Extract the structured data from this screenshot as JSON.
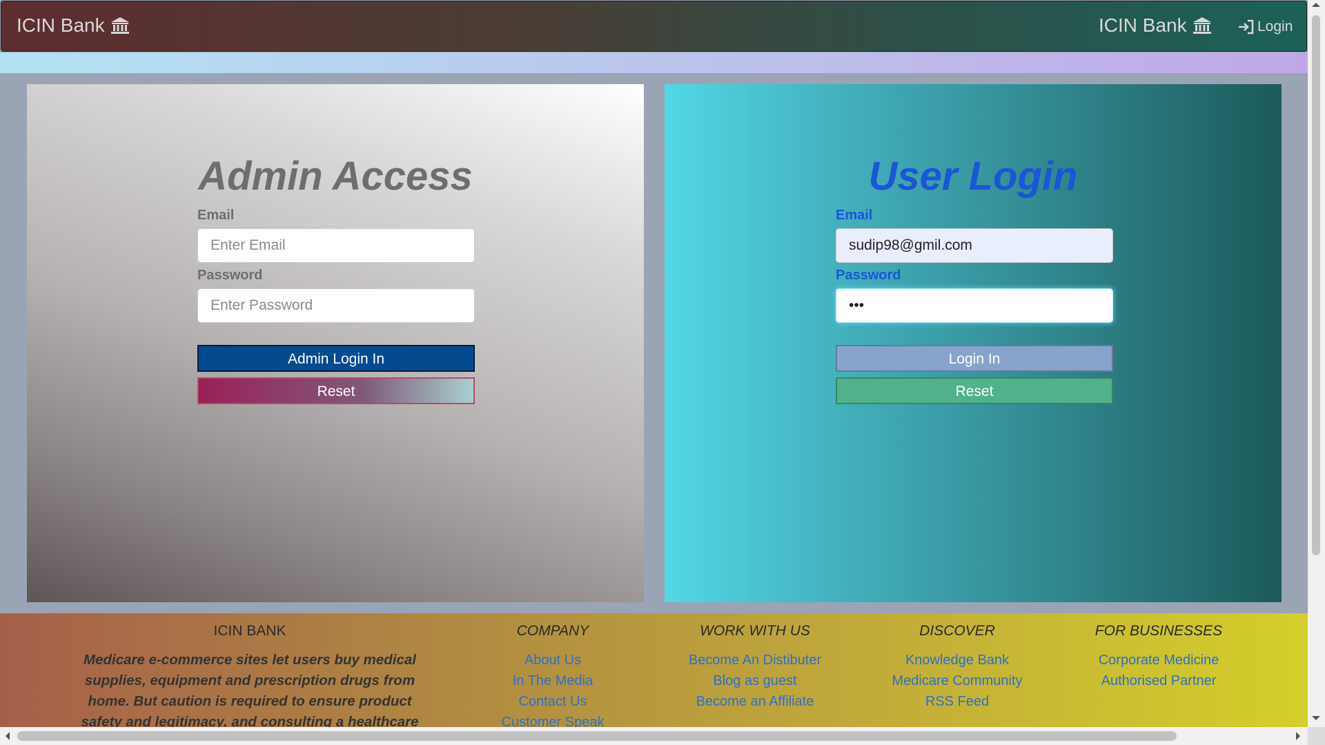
{
  "navbar": {
    "brand_left": "ICIN Bank",
    "brand_right": "ICIN Bank",
    "login_label": "Login",
    "brand_icon": "bank-icon",
    "login_icon": "sign-in-icon"
  },
  "admin": {
    "title": "Admin Access",
    "email_label": "Email",
    "email_placeholder": "Enter Email",
    "password_label": "Password",
    "password_placeholder": "Enter Password",
    "login_button": "Admin Login In",
    "reset_button": "Reset"
  },
  "user": {
    "title": "User Login",
    "email_label": "Email",
    "email_value": "sudip98@gmil.com",
    "password_label": "Password",
    "password_value": "•••",
    "login_button": "Login In",
    "reset_button": "Reset"
  },
  "footer": {
    "about": {
      "heading": "ICIN BANK",
      "text": "Medicare e-commerce sites let users buy medical supplies, equipment and prescription drugs from home. But caution is required to ensure product safety and legitimacy, and consulting a healthcare"
    },
    "company": {
      "heading": "COMPANY",
      "links": [
        "About Us",
        "In The Media",
        "Contact Us",
        "Customer Speak"
      ]
    },
    "work": {
      "heading": "WORK WITH US",
      "links": [
        "Become An Distibuter",
        "Blog as guest",
        "Become an Affiliate"
      ]
    },
    "discover": {
      "heading": "DISCOVER",
      "links": [
        "Knowledge Bank",
        "Medicare Community",
        "RSS Feed"
      ]
    },
    "business": {
      "heading": "FOR BUSINESSES",
      "links": [
        "Corporate Medicine",
        "Authorised Partner"
      ]
    }
  },
  "colors": {
    "admin_button": "#054a8f",
    "user_accent": "#1a56d6",
    "user_reset": "#4fb28a",
    "link": "#2e6fc7"
  }
}
